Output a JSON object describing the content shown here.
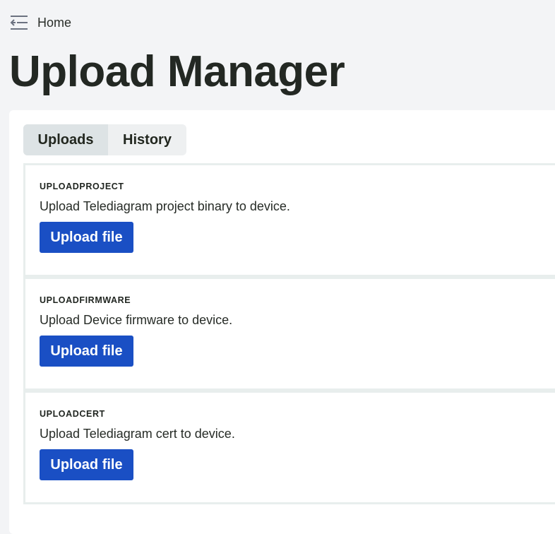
{
  "nav": {
    "home_label": "Home"
  },
  "page": {
    "title": "Upload Manager"
  },
  "tabs": [
    {
      "label": "Uploads",
      "active": true
    },
    {
      "label": "History",
      "active": false
    }
  ],
  "uploads": [
    {
      "key": "UPLOADPROJECT",
      "description": "Upload Telediagram project binary to device.",
      "button_label": "Upload file"
    },
    {
      "key": "UPLOADFIRMWARE",
      "description": "Upload Device firmware to device.",
      "button_label": "Upload file"
    },
    {
      "key": "UPLOADCERT",
      "description": "Upload Telediagram cert to device.",
      "button_label": "Upload file"
    }
  ],
  "colors": {
    "primary_button": "#1a4fc4",
    "page_background": "#f3f4f6",
    "active_tab": "#dde3e5"
  },
  "icons": {
    "menu": "collapse-menu-icon"
  }
}
